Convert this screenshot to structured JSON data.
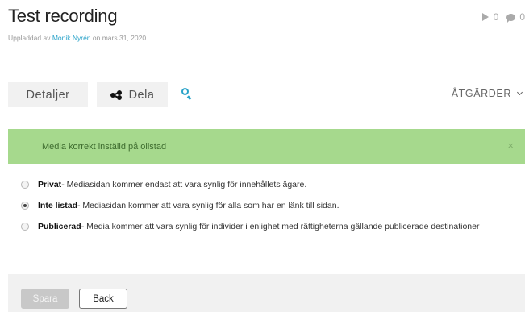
{
  "header": {
    "title": "Test recording",
    "subtitle_prefix": "Uppladdad av ",
    "author": "Monik Nyrén",
    "subtitle_suffix": " on mars 31, 2020"
  },
  "stats": {
    "plays": "0",
    "comments": "0"
  },
  "tabs": {
    "details": "Detaljer",
    "share": "Dela"
  },
  "actions_label": "ÅTGÄRDER",
  "alert": {
    "message": "Media korrekt inställd på olistad",
    "close": "×"
  },
  "options": [
    {
      "title": "Privat",
      "desc": " - Mediasidan kommer endast att vara synlig för innehållets ägare.",
      "checked": false
    },
    {
      "title": "Inte listad",
      "desc": " - Mediasidan kommer att vara synlig för alla som har en länk till sidan.",
      "checked": true
    },
    {
      "title": "Publicerad",
      "desc": " - Media kommer att vara synlig för individer i enlighet med rättigheterna gällande publicerade destinationer",
      "checked": false
    }
  ],
  "footer": {
    "save": "Spara",
    "back": "Back"
  },
  "colors": {
    "accent": "#2aa3c9",
    "alert_bg": "#a6d98d",
    "alert_text": "#3d6b2e"
  }
}
